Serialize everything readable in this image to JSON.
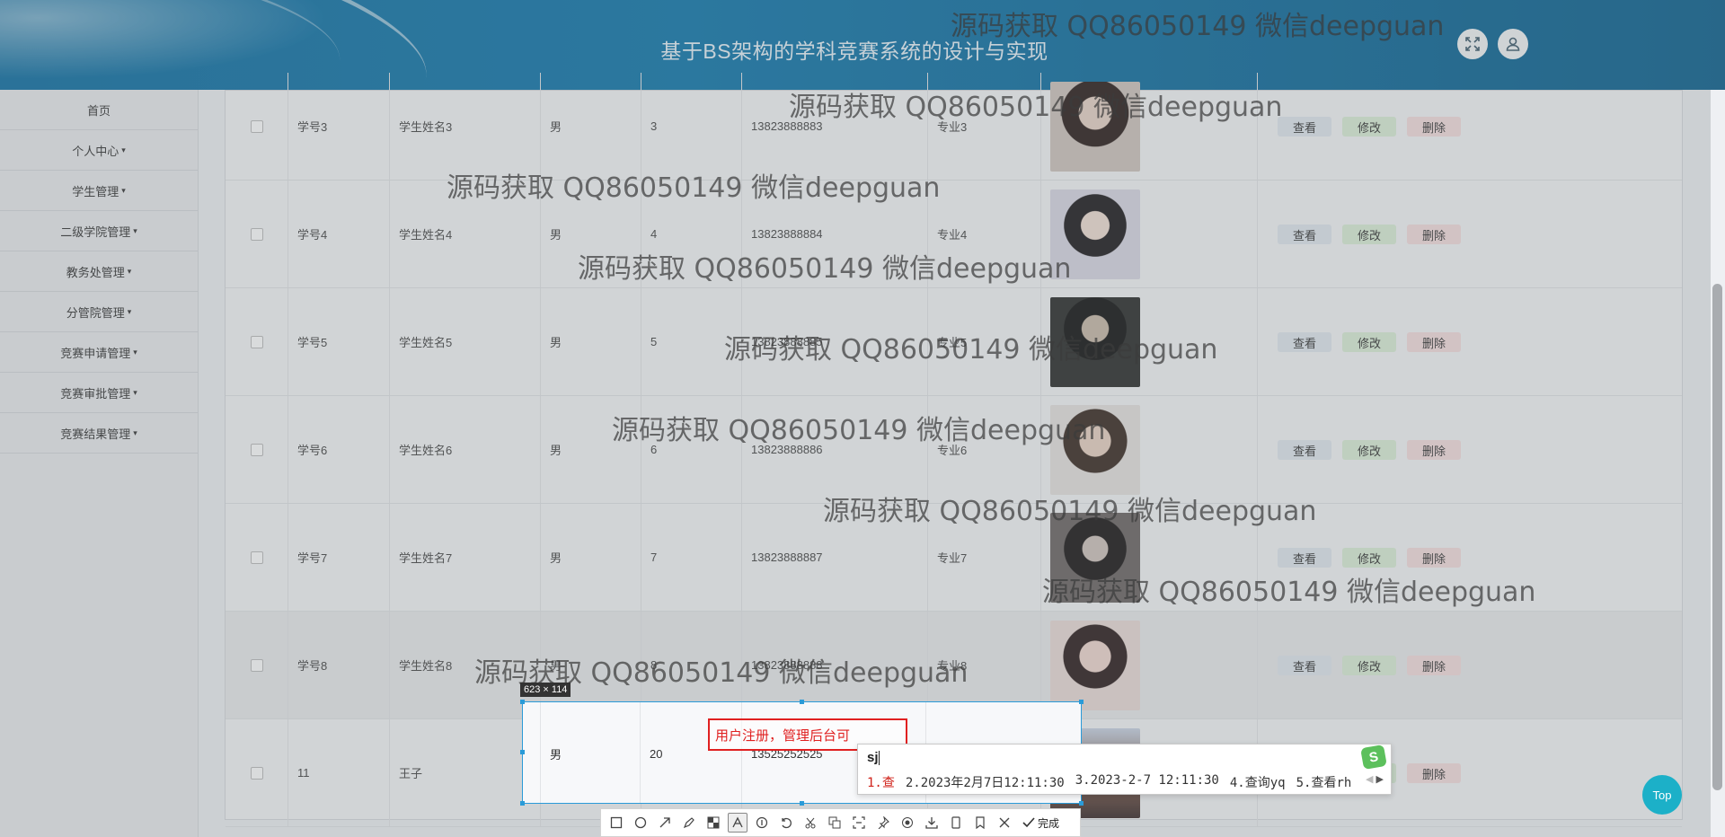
{
  "header": {
    "title": "基于BS架构的学科竞赛系统的设计与实现",
    "fullscreen_icon": "fullscreen-icon",
    "user_icon": "user-icon"
  },
  "sidebar": {
    "items": [
      {
        "label": "首页",
        "has_caret": false
      },
      {
        "label": "个人中心",
        "has_caret": true
      },
      {
        "label": "学生管理",
        "has_caret": true
      },
      {
        "label": "二级学院管理",
        "has_caret": true
      },
      {
        "label": "教务处管理",
        "has_caret": true
      },
      {
        "label": "分管院管理",
        "has_caret": true
      },
      {
        "label": "竞赛申请管理",
        "has_caret": true
      },
      {
        "label": "竞赛审批管理",
        "has_caret": true
      },
      {
        "label": "竞赛结果管理",
        "has_caret": true
      }
    ],
    "caret": "▾"
  },
  "table": {
    "rows": [
      {
        "id": "学号3",
        "name": "学生姓名3",
        "gender": "男",
        "age": "3",
        "phone": "13823888883",
        "major": "专业3"
      },
      {
        "id": "学号4",
        "name": "学生姓名4",
        "gender": "男",
        "age": "4",
        "phone": "13823888884",
        "major": "专业4"
      },
      {
        "id": "学号5",
        "name": "学生姓名5",
        "gender": "男",
        "age": "5",
        "phone": "13823888885",
        "major": "专业5"
      },
      {
        "id": "学号6",
        "name": "学生姓名6",
        "gender": "男",
        "age": "6",
        "phone": "13823888886",
        "major": "专业6"
      },
      {
        "id": "学号7",
        "name": "学生姓名7",
        "gender": "男",
        "age": "7",
        "phone": "13823888887",
        "major": "专业7"
      },
      {
        "id": "学号8",
        "name": "学生姓名8",
        "gender": "男",
        "age": "8",
        "phone": "13823888888",
        "major": "专业8"
      },
      {
        "id": "11",
        "name": "王子",
        "gender": "男",
        "age": "20",
        "phone": "13525252525",
        "major": ""
      }
    ],
    "actions": {
      "view": "查看",
      "edit": "修改",
      "delete": "删除"
    }
  },
  "watermark": "源码获取 QQ86050149 微信deepguan",
  "screenshot_tool": {
    "size_label": "623 × 114",
    "annotation_text": "用户注册，管理后台可",
    "done_label": "完成",
    "ime": {
      "input": "sj",
      "candidates": [
        "1.查",
        "2.2023年2月7日12:11:30",
        "3.2023-2-7 12:11:30",
        "4.查询yq",
        "5.查看rh"
      ],
      "logo": "S"
    }
  },
  "top_button": "Top"
}
